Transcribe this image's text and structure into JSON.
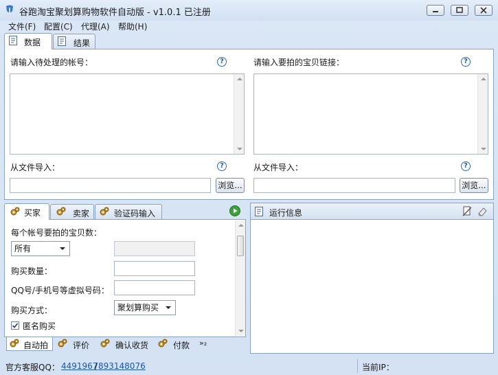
{
  "window": {
    "title": "谷跑淘宝聚划算购物软件自动版 - v1.0.1 已注册"
  },
  "menu": [
    "文件(F)",
    "配置(C)",
    "代理(A)",
    "帮助(H)"
  ],
  "top_tabs": [
    {
      "label": "数据",
      "icon": "document-icon",
      "active": true
    },
    {
      "label": "结果",
      "icon": "document-icon",
      "active": false
    }
  ],
  "data_panel": {
    "accounts_label": "请输入待处理的帐号：",
    "links_label": "请输入要拍的宝贝链接：",
    "import_label_left": "从文件导入：",
    "import_label_right": "从文件导入：",
    "browse_left": "浏览...",
    "browse_right": "浏览...",
    "help_glyph": "?"
  },
  "role_tabs": [
    {
      "label": "买家",
      "icon": "gear-icon",
      "active": true
    },
    {
      "label": "卖家",
      "icon": "gear-icon",
      "active": false
    },
    {
      "label": "验证码输入",
      "icon": "gear-icon",
      "active": false
    }
  ],
  "buyer_form": {
    "items_per_account_label": "每个帐号要拍的宝贝数：",
    "items_per_account_value": "所有",
    "quantity_label": "购买数量：",
    "qq_label": "QQ号/手机号等虚拟号码：",
    "purchase_method_label": "购买方式：",
    "purchase_method_value": "聚划算购买",
    "anonymous_label": "匿名购买",
    "anonymous_checked": true
  },
  "bottom_tabs": [
    {
      "label": "自动拍",
      "active": true
    },
    {
      "label": "评价",
      "active": false
    },
    {
      "label": "确认收货",
      "active": false
    },
    {
      "label": "付款",
      "active": false
    },
    {
      "label": "»₂",
      "active": false
    }
  ],
  "run_info": {
    "title": "运行信息"
  },
  "status": {
    "qq_label": "官方客服QQ：",
    "qq1": "4491967",
    "sep": "/",
    "qq2": "893148076",
    "ip_label": "当前IP："
  },
  "colors": {
    "accent": "#2f6bb5",
    "link": "#1c56a8",
    "frame": "#d3e2f3",
    "play": "#3aa23a"
  }
}
